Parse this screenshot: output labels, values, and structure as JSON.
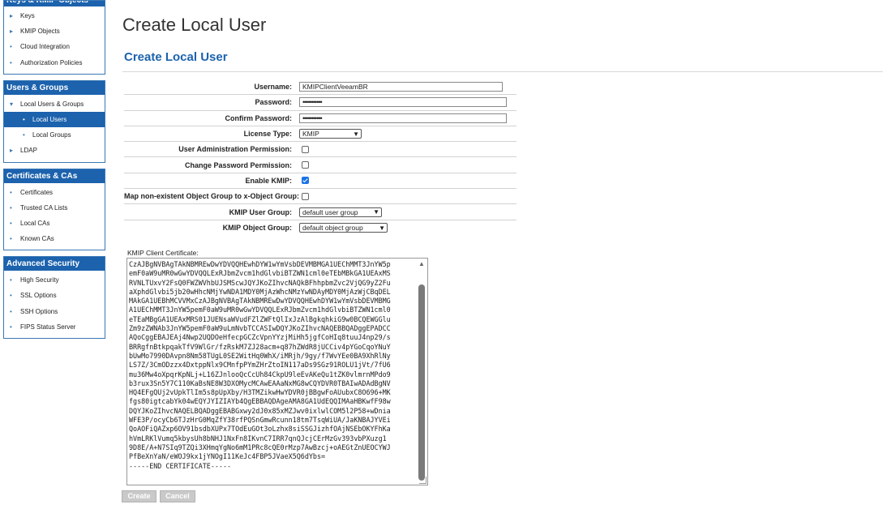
{
  "sidebar": {
    "keys_panel": {
      "title": "Keys & KMIP Objects",
      "items": [
        {
          "label": "Keys"
        },
        {
          "label": "KMIP Objects"
        },
        {
          "label": "Cloud Integration"
        },
        {
          "label": "Authorization Policies"
        }
      ]
    },
    "users_panel": {
      "title": "Users & Groups",
      "items": [
        {
          "label": "Local Users & Groups"
        },
        {
          "label": "Local Users"
        },
        {
          "label": "Local Groups"
        },
        {
          "label": "LDAP"
        }
      ]
    },
    "certs_panel": {
      "title": "Certificates & CAs",
      "items": [
        {
          "label": "Certificates"
        },
        {
          "label": "Trusted CA Lists"
        },
        {
          "label": "Local CAs"
        },
        {
          "label": "Known CAs"
        }
      ]
    },
    "security_panel": {
      "title": "Advanced Security",
      "items": [
        {
          "label": "High Security"
        },
        {
          "label": "SSL Options"
        },
        {
          "label": "SSH Options"
        },
        {
          "label": "FIPS Status Server"
        }
      ]
    }
  },
  "page": {
    "title": "Create Local User",
    "section_title": "Create Local User"
  },
  "form": {
    "username_label": "Username:",
    "username_value": "KMIPClientVeeamBR",
    "password_label": "Password:",
    "password_value": "•••••••••••",
    "confirm_label": "Confirm Password:",
    "confirm_value": "•••••••••••",
    "license_label": "License Type:",
    "license_value": "KMIP",
    "user_admin_label": "User Administration Permission:",
    "user_admin_checked": false,
    "change_pw_label": "Change Password Permission:",
    "change_pw_checked": false,
    "enable_kmip_label": "Enable KMIP:",
    "enable_kmip_checked": true,
    "map_group_label": "Map non-existent Object Group to x-Object Group:",
    "map_group_checked": false,
    "kmip_user_group_label": "KMIP User Group:",
    "kmip_user_group_value": "default user group",
    "kmip_object_group_label": "KMIP Object Group:",
    "kmip_object_group_value": "default object group"
  },
  "certificate": {
    "label": "KMIP Client Certificate:",
    "text": "CzAJBgNVBAgTAkNBMREwDwYDVQQHEwhDYW1wYmVsbDEVMBMGA1UEChMMT3JnYW5p\nemF0aW9uMR0wGwYDVQQLExRJbmZvcm1hdGlvbiBTZWN1cml0eTEbMBkGA1UEAxMS\nRVNLTUxvY2FsQ0FWZWVhbUJSMScwJQYJKoZIhvcNAQkBFhhpbmZvc2VjQG9yZ2Fu\naXphdGlvbi5jb20wHhcNMjYwNDA1MDY0MjAzWhcNMzYwNDAyMDY0MjAzWjCBqDEL\nMAkGA1UEBhMCVVMxCzAJBgNVBAgTAkNBMREwDwYDVQQHEwhDYW1wYmVsbDEVMBMG\nA1UEChMMT3JnYW5pemF0aW9uMR0wGwYDVQQLExRJbmZvcm1hdGlvbiBTZWN1cml0\neTEaMBgGA1UEAxMRS01JUENsaWVudFZlZWFtQlIxJzAlBgkqhkiG9w0BCQEWGGlu\nZm9zZWNAb3JnYW5pemF0aW9uLmNvbTCCASIwDQYJKoZIhvcNAQEBBQADggEPADCC\nAQoCggEBAJEAj4Nwp2UQDOeHfecpGCZcVpnYYzjMiHh5jgfCoHIq8tuuJ4np29/s\nBRRgfnBtkpqakTfV9WlGr/fzRskM7ZJ28acm+q87hZWdR8jUCCiv4pYGoCqoYNuY\nbUwMo7990DAvpn8Nm58TUgL0SE2WitHq0WhX/iMRjh/9gy/f7WvYEe0BA9XhRlNy\nLS7Z/3CmODzzx4DxtppNlx9CMnfpPYmZHrZtoIN117aDs9SGz91ROLU1jVt/7fU6\nmu36Mw4oXpqrKpNLj+L16ZJnlooQcCcUh84CkpU9leEvAKeQu1tZK0vlmrnMPdo9\nb3rux3Sn5Y7C110KaBsNE8W3DXOMycMCAwEAAaNxMG8wCQYDVR0TBAIwADAdBgNV\nHQ4EFgQUj2vUpkTlIm5s8pUpXby/H3TMZikwHwYDVR0jBBgwFoAUubxC8O696+MK\nfgs80igtcabYk04wEQYJYIZIAYb4QgEBBAQDAgeAMA8GA1UdEQQIMAaHBKwfF98w\nDQYJKoZIhvcNAQELBQADggEBABGxwy2dJ0x85xMZJwv0ixlwlCOM5l2P58+wDnia\nWFE3P/ocyCb6TJzHrG0MqZfY38rfPQSnGmwRcunn18tm7TsqWiUA/JaKNBAJYVEi\nQoAOFiQAZxp6OV91bsdbXUPx7TOdEuGOt3oLzhx8siSSGJizhfOAjNSEbOKYFhKa\nhVmLRKlVumq5kbysUh8bNHJ1NxFn8IKvnC7IRR7qnQJcjCErMzGv393vbPXuzg1\n9D8E/A+N7SIq9TZQi3XHmqYgNo6mM1PRc8cQE0rMzp7AwBzcj+oAEGtZnUEOCYWJ\nPfBeXnYaN/eWOJ9kx1jYNOgI11KeJc4FBP5JVaeX5Q6dYbs=\n-----END CERTIFICATE-----"
  },
  "buttons": {
    "create": "Create",
    "cancel": "Cancel"
  }
}
